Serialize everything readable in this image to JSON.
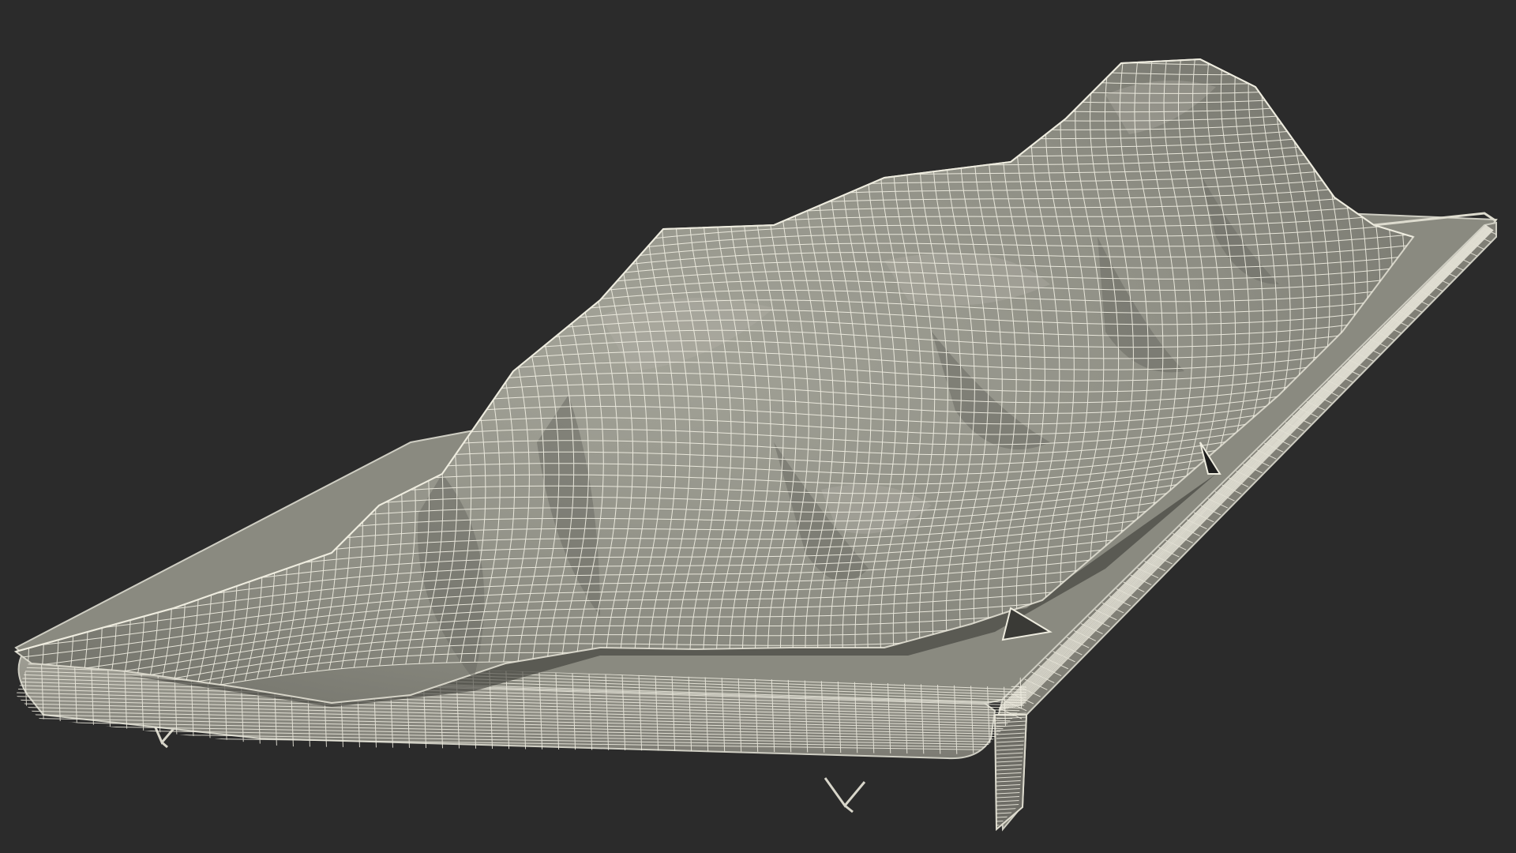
{
  "scene": {
    "background_color": "#2b2b2b",
    "surface_color": "#8e8e84",
    "surface_shade_color": "#6f6f67",
    "surface_light_color": "#a3a398",
    "wire_color": "#f2f0e4",
    "edge_color": "#b8b7ac",
    "shadow_color": "#1e1e1e"
  }
}
